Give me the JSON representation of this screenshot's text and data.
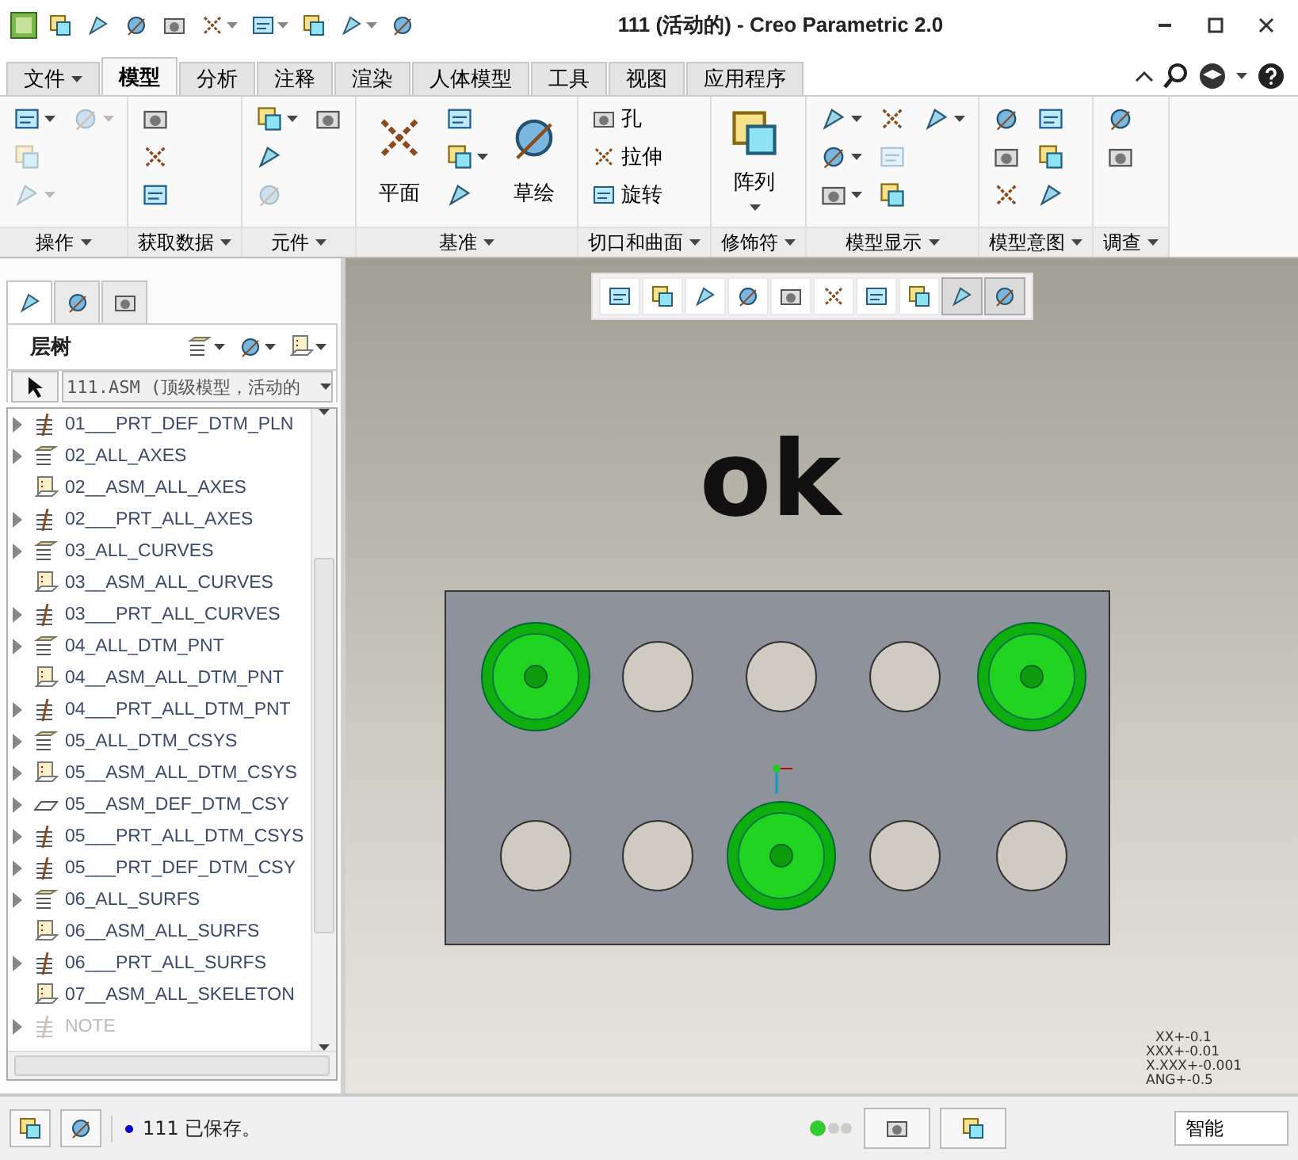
{
  "window": {
    "title": "111 (活动的) - Creo Parametric 2.0"
  },
  "quick_access": [
    {
      "dropdown": false
    },
    {
      "dropdown": false
    },
    {
      "dropdown": false
    },
    {
      "dropdown": false
    },
    {
      "dropdown": true
    },
    {
      "dropdown": true
    },
    {
      "dropdown": false
    },
    {
      "dropdown": true
    },
    {
      "dropdown": false
    }
  ],
  "tabs": [
    {
      "label": "文件",
      "selected": false,
      "kind": "menu"
    },
    {
      "label": "模型",
      "selected": true,
      "kind": "tab"
    },
    {
      "label": "分析",
      "selected": false,
      "kind": "tab"
    },
    {
      "label": "注释",
      "selected": false,
      "kind": "tab"
    },
    {
      "label": "渲染",
      "selected": false,
      "kind": "tab"
    },
    {
      "label": "人体模型",
      "selected": false,
      "kind": "tab"
    },
    {
      "label": "工具",
      "selected": false,
      "kind": "tab"
    },
    {
      "label": "视图",
      "selected": false,
      "kind": "tab"
    },
    {
      "label": "应用程序",
      "selected": false,
      "kind": "tab"
    }
  ],
  "ribbon": {
    "groups": [
      {
        "label": "操作",
        "buttons": [
          {
            "kind": "icon",
            "dropdown": true,
            "disabled": false
          },
          {
            "kind": "icon",
            "dropdown": false,
            "disabled": true
          },
          {
            "kind": "icon",
            "dropdown": true,
            "disabled": true
          },
          {
            "kind": "icon",
            "dropdown": true,
            "disabled": true
          }
        ]
      },
      {
        "label": "获取数据",
        "buttons": [
          {
            "kind": "icon",
            "dropdown": false,
            "disabled": false
          },
          {
            "kind": "icon",
            "dropdown": false,
            "disabled": false
          },
          {
            "kind": "icon",
            "dropdown": false,
            "disabled": false
          }
        ]
      },
      {
        "label": "元件",
        "buttons": [
          {
            "kind": "icon",
            "dropdown": true,
            "disabled": false
          },
          {
            "kind": "icon",
            "dropdown": false,
            "disabled": false
          },
          {
            "kind": "icon",
            "dropdown": false,
            "disabled": true
          },
          {
            "kind": "icon",
            "dropdown": false,
            "disabled": false
          }
        ]
      },
      {
        "label": "基准",
        "buttons": [
          {
            "kind": "large",
            "label": "平面",
            "dropdown": false,
            "disabled": false
          },
          {
            "kind": "icon",
            "dropdown": false,
            "disabled": false
          },
          {
            "kind": "icon",
            "dropdown": true,
            "disabled": false
          },
          {
            "kind": "icon",
            "dropdown": false,
            "disabled": false
          },
          {
            "kind": "large",
            "label": "草绘",
            "dropdown": false,
            "disabled": false
          }
        ]
      },
      {
        "label": "切口和曲面",
        "buttons": [
          {
            "kind": "small",
            "label": "孔",
            "dropdown": false,
            "disabled": false
          },
          {
            "kind": "small",
            "label": "拉伸",
            "dropdown": false,
            "disabled": false
          },
          {
            "kind": "small",
            "label": "旋转",
            "dropdown": false,
            "disabled": false
          }
        ]
      },
      {
        "label": "修饰符",
        "buttons": [
          {
            "kind": "large",
            "label": "阵列",
            "dropdown": true,
            "disabled": false
          }
        ]
      },
      {
        "label": "模型显示",
        "buttons": [
          {
            "kind": "icon",
            "dropdown": true,
            "disabled": false
          },
          {
            "kind": "icon",
            "dropdown": true,
            "disabled": false
          },
          {
            "kind": "icon",
            "dropdown": true,
            "disabled": false
          },
          {
            "kind": "icon",
            "dropdown": false,
            "disabled": false
          },
          {
            "kind": "icon",
            "dropdown": false,
            "disabled": true
          },
          {
            "kind": "icon",
            "dropdown": false,
            "disabled": false
          },
          {
            "kind": "icon",
            "dropdown": true,
            "disabled": false
          }
        ]
      },
      {
        "label": "模型意图",
        "buttons": [
          {
            "kind": "icon",
            "dropdown": false,
            "disabled": false
          },
          {
            "kind": "icon",
            "dropdown": false,
            "disabled": false
          },
          {
            "kind": "icon",
            "dropdown": false,
            "disabled": false
          },
          {
            "kind": "icon",
            "dropdown": false,
            "disabled": false
          },
          {
            "kind": "icon",
            "dropdown": false,
            "disabled": false
          },
          {
            "kind": "icon",
            "dropdown": false,
            "disabled": false
          }
        ]
      },
      {
        "label": "调查",
        "buttons": [
          {
            "kind": "icon",
            "dropdown": false,
            "disabled": false
          },
          {
            "kind": "icon",
            "dropdown": false,
            "disabled": false
          }
        ]
      }
    ]
  },
  "sidebar": {
    "tabs": [
      {
        "selected": true
      },
      {
        "selected": false
      },
      {
        "selected": false
      }
    ],
    "title": "层树",
    "model_selector": "111.ASM (顶级模型，活动的",
    "items": [
      {
        "label": "01___PRT_DEF_DTM_PLN",
        "kind": "part-layer",
        "expandable": true,
        "disabled": false
      },
      {
        "label": "02_ALL_AXES",
        "kind": "layer",
        "expandable": true,
        "disabled": false
      },
      {
        "label": "02__ASM_ALL_AXES",
        "kind": "rule",
        "expandable": false,
        "disabled": false
      },
      {
        "label": "02___PRT_ALL_AXES",
        "kind": "part-layer",
        "expandable": true,
        "disabled": false
      },
      {
        "label": "03_ALL_CURVES",
        "kind": "layer",
        "expandable": true,
        "disabled": false
      },
      {
        "label": "03__ASM_ALL_CURVES",
        "kind": "rule",
        "expandable": false,
        "disabled": false
      },
      {
        "label": "03___PRT_ALL_CURVES",
        "kind": "part-layer",
        "expandable": true,
        "disabled": false
      },
      {
        "label": "04_ALL_DTM_PNT",
        "kind": "layer",
        "expandable": true,
        "disabled": false
      },
      {
        "label": "04__ASM_ALL_DTM_PNT",
        "kind": "rule",
        "expandable": false,
        "disabled": false
      },
      {
        "label": "04___PRT_ALL_DTM_PNT",
        "kind": "part-layer",
        "expandable": true,
        "disabled": false
      },
      {
        "label": "05_ALL_DTM_CSYS",
        "kind": "layer",
        "expandable": true,
        "disabled": false
      },
      {
        "label": "05__ASM_ALL_DTM_CSYS",
        "kind": "rule",
        "expandable": true,
        "disabled": false
      },
      {
        "label": "05__ASM_DEF_DTM_CSY",
        "kind": "plane",
        "expandable": true,
        "disabled": false
      },
      {
        "label": "05___PRT_ALL_DTM_CSYS",
        "kind": "part-layer",
        "expandable": true,
        "disabled": false
      },
      {
        "label": "05___PRT_DEF_DTM_CSY",
        "kind": "part-layer",
        "expandable": true,
        "disabled": false
      },
      {
        "label": "06_ALL_SURFS",
        "kind": "layer",
        "expandable": true,
        "disabled": false
      },
      {
        "label": "06__ASM_ALL_SURFS",
        "kind": "rule",
        "expandable": false,
        "disabled": false
      },
      {
        "label": "06___PRT_ALL_SURFS",
        "kind": "part-layer",
        "expandable": true,
        "disabled": false
      },
      {
        "label": "07__ASM_ALL_SKELETON",
        "kind": "rule",
        "expandable": false,
        "disabled": false
      },
      {
        "label": "NOTE",
        "kind": "part-layer",
        "expandable": true,
        "disabled": true
      }
    ]
  },
  "graphics": {
    "toolbar": [
      {
        "selected": false
      },
      {
        "selected": false
      },
      {
        "selected": false
      },
      {
        "selected": false
      },
      {
        "selected": false
      },
      {
        "selected": false
      },
      {
        "selected": false
      },
      {
        "selected": false
      },
      {
        "selected": true
      },
      {
        "selected": true
      }
    ],
    "heading": "ok",
    "holes": [
      {
        "placed": true
      },
      {
        "placed": false
      },
      {
        "placed": false
      },
      {
        "placed": false
      },
      {
        "placed": true
      },
      {
        "placed": false
      },
      {
        "placed": false
      },
      {
        "placed": true
      },
      {
        "placed": false
      },
      {
        "placed": false
      }
    ],
    "tolerances": [
      "XX+-0.1",
      "XXX+-0.01",
      "X.XXX+-0.001",
      "ANG+-0.5"
    ]
  },
  "status_bar": {
    "message": "111 已保存。",
    "filter": "智能"
  }
}
